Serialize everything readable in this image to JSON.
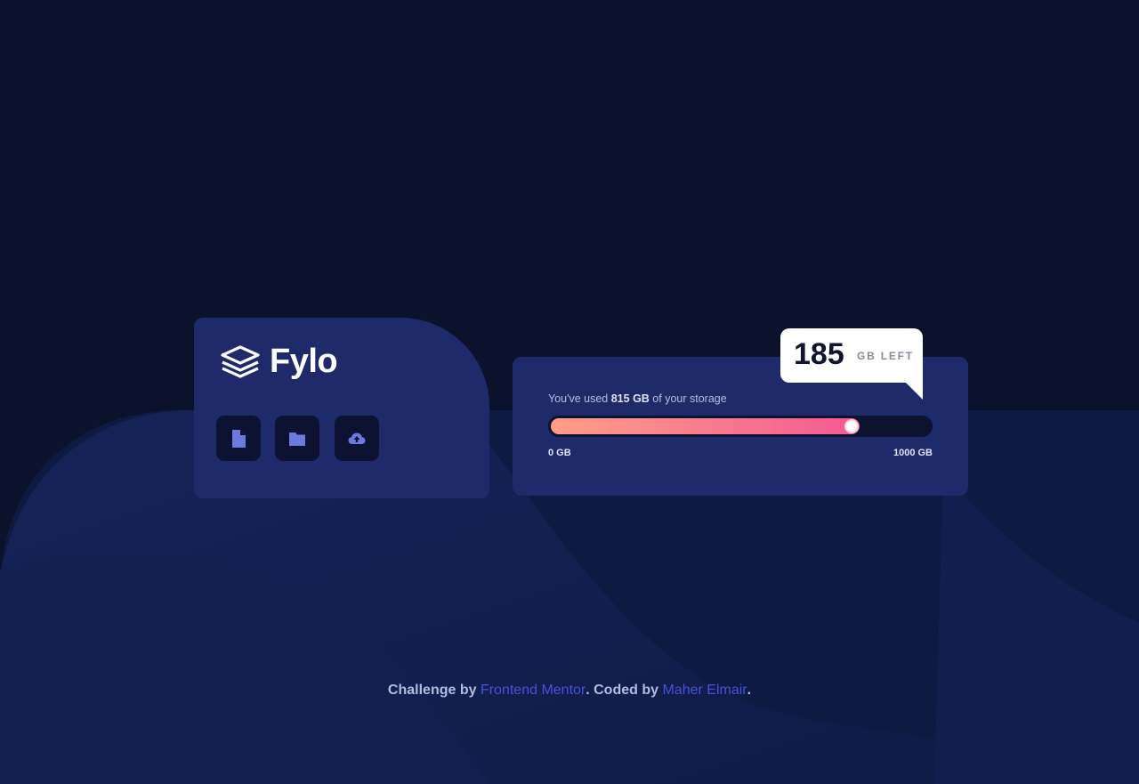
{
  "colors": {
    "background": "#0c122c",
    "card": "#1f2a6a",
    "button_bg": "#0d1233",
    "icon": "#6c7bdb",
    "gradient_start": "#fd9e89",
    "gradient_end": "#f35a93",
    "link": "#4752d8"
  },
  "brand": {
    "name": "Fylo",
    "logo_icon": "layers-icon"
  },
  "toolbar": {
    "buttons": [
      {
        "icon": "document-icon"
      },
      {
        "icon": "folder-icon"
      },
      {
        "icon": "cloud-upload-icon"
      }
    ]
  },
  "storage": {
    "used_prefix": "You've used ",
    "used_amount": "815 GB",
    "used_suffix": " of your storage",
    "progress_fraction": 0.815,
    "min_label": "0 GB",
    "max_label": "1000 GB"
  },
  "callout": {
    "value": "185",
    "unit": "GB LEFT"
  },
  "footer": {
    "prefix": "Challenge by ",
    "link1": "Frontend Mentor",
    "middle": ". Coded by ",
    "link2": "Maher Elmair",
    "suffix": "."
  }
}
